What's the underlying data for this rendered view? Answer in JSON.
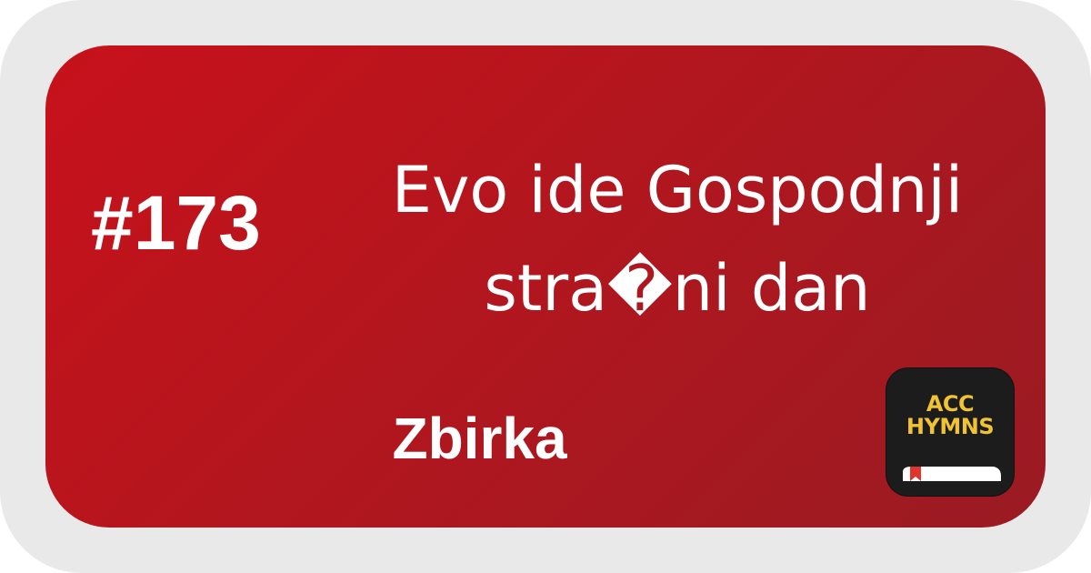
{
  "hymn": {
    "number": "#173",
    "title_line1": "Evo ide Gospodnji",
    "title_line2": "stra�ni dan",
    "collection": "Zbirka"
  },
  "logo": {
    "line1": "ACC",
    "line2": "HYMNS",
    "icon": "book-bookmark-icon",
    "text_color": "#f1c232",
    "background_color": "#1c1c1c"
  },
  "colors": {
    "card_start": "#c8111b",
    "card_end": "#9a1b22",
    "frame": "#e9e9e9",
    "text": "#ffffff"
  }
}
